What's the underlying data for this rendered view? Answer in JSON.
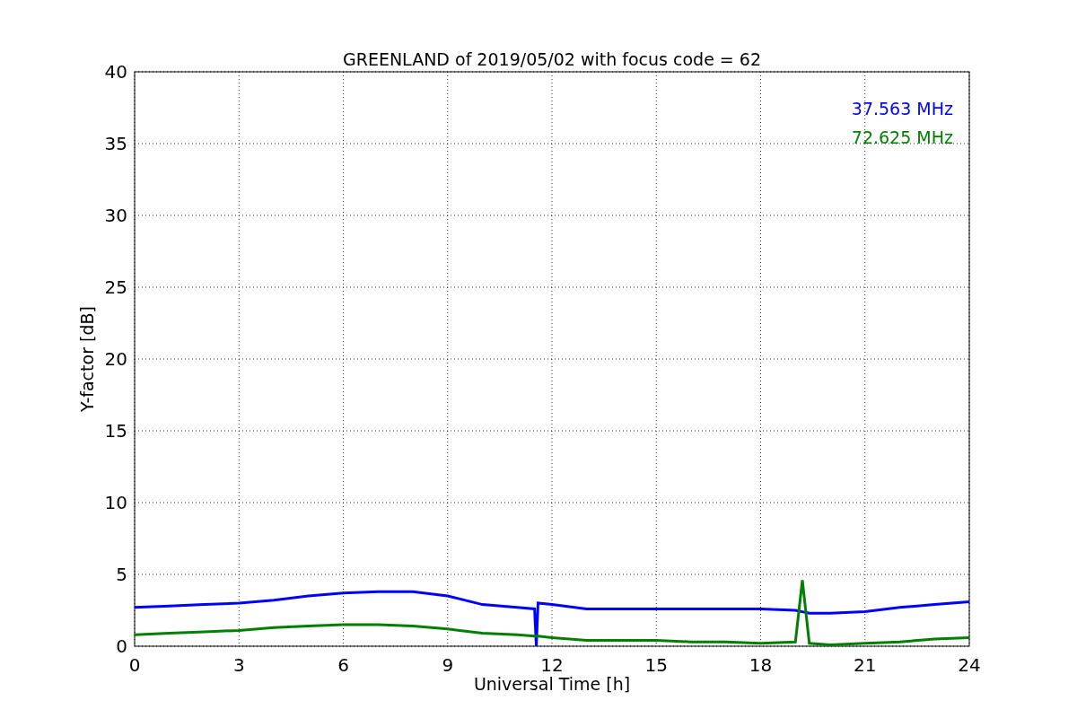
{
  "chart_data": {
    "type": "line",
    "title": "GREENLAND of 2019/05/02 with focus code = 62",
    "xlabel": "Universal Time [h]",
    "ylabel": "Y-factor [dB]",
    "x": [
      0,
      1,
      2,
      3,
      4,
      5,
      6,
      7,
      8,
      9,
      10,
      11,
      11.5,
      11.55,
      11.6,
      12,
      13,
      14,
      15,
      16,
      17,
      18,
      19,
      19.2,
      19.4,
      20,
      21,
      22,
      23,
      24
    ],
    "series": [
      {
        "name": "37.563 MHz",
        "color": "#0000ff",
        "values": [
          2.7,
          2.8,
          2.9,
          3.0,
          3.2,
          3.5,
          3.7,
          3.8,
          3.8,
          3.5,
          2.9,
          2.7,
          2.6,
          0,
          3.0,
          2.9,
          2.6,
          2.6,
          2.6,
          2.6,
          2.6,
          2.6,
          2.5,
          2.4,
          2.3,
          2.3,
          2.4,
          2.7,
          2.9,
          3.1
        ]
      },
      {
        "name": "72.625 MHz",
        "color": "#008000",
        "values": [
          0.8,
          0.9,
          1.0,
          1.1,
          1.3,
          1.4,
          1.5,
          1.5,
          1.4,
          1.2,
          0.9,
          0.8,
          0.7,
          0.7,
          0.7,
          0.6,
          0.4,
          0.4,
          0.4,
          0.3,
          0.3,
          0.2,
          0.3,
          4.6,
          0.2,
          0.1,
          0.2,
          0.3,
          0.5,
          0.6
        ]
      }
    ],
    "grid": true,
    "xlim": [
      0,
      24
    ],
    "ylim": [
      0,
      40
    ],
    "xticks": [
      0,
      3,
      6,
      9,
      12,
      15,
      18,
      21,
      24
    ],
    "yticks": [
      0,
      5,
      10,
      15,
      20,
      25,
      30,
      35,
      40
    ]
  }
}
